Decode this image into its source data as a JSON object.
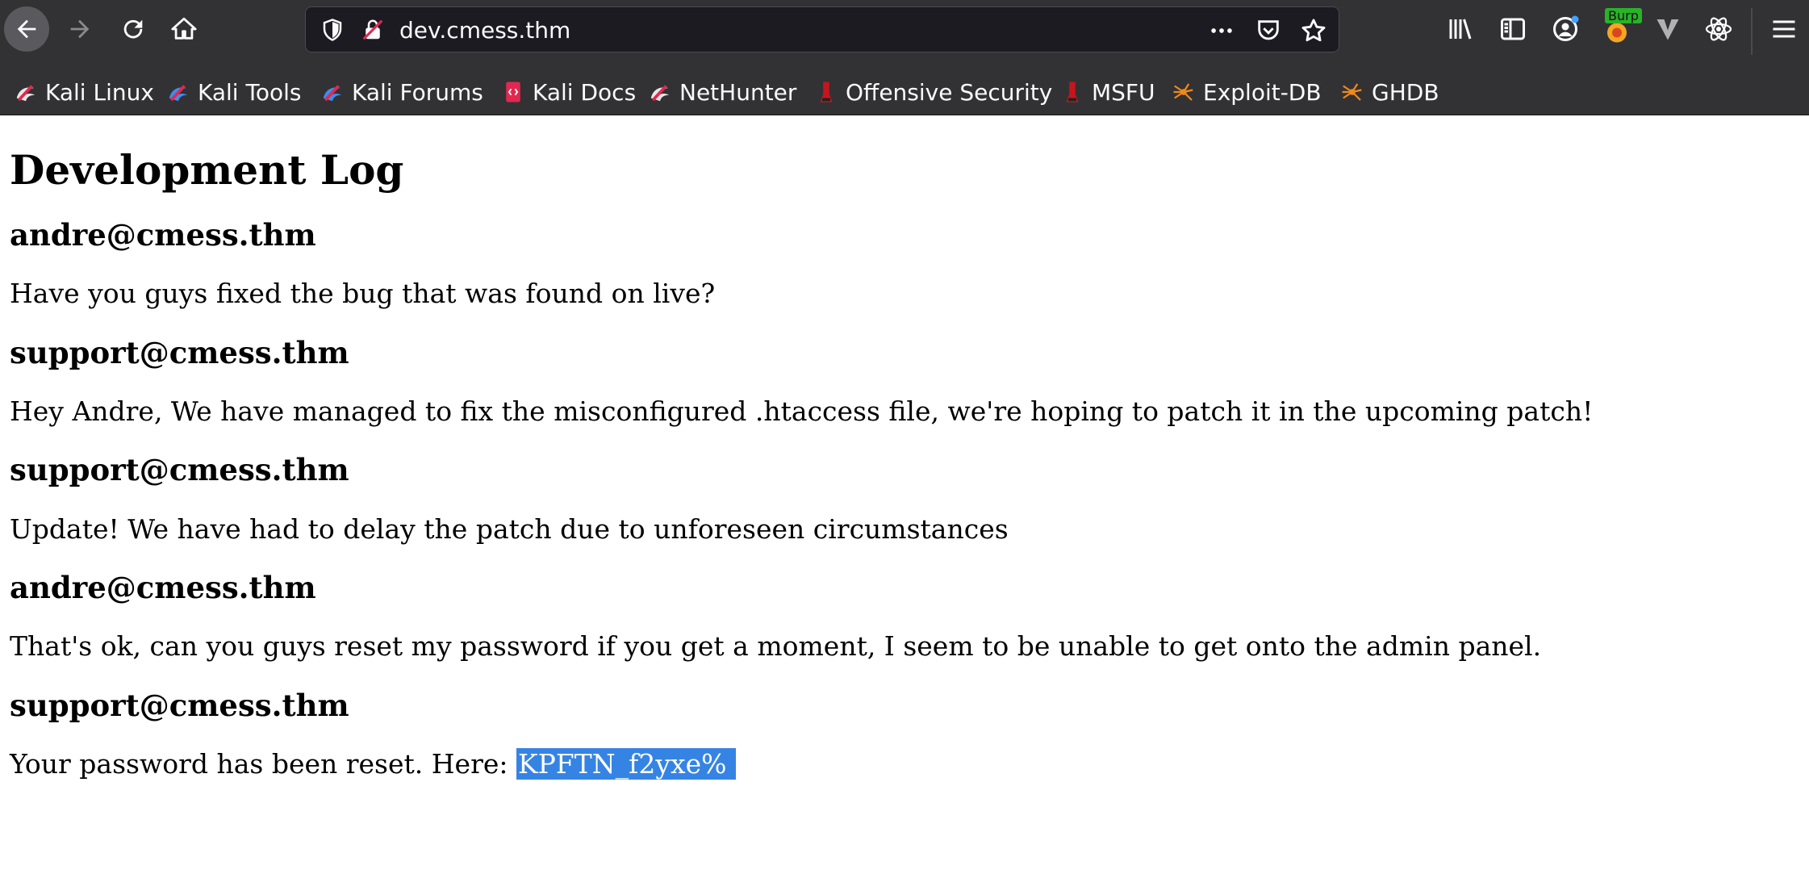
{
  "browser": {
    "url": "dev.cmess.thm",
    "burp_badge": "Burp",
    "bookmarks": [
      {
        "label": "Kali Linux",
        "icon": "kali-dragon-icon"
      },
      {
        "label": "Kali Tools",
        "icon": "kali-tools-icon"
      },
      {
        "label": "Kali Forums",
        "icon": "kali-forums-icon"
      },
      {
        "label": "Kali Docs",
        "icon": "kali-docs-icon"
      },
      {
        "label": "NetHunter",
        "icon": "nethunter-icon"
      },
      {
        "label": "Offensive Security",
        "icon": "offsec-icon"
      },
      {
        "label": "MSFU",
        "icon": "msfu-icon"
      },
      {
        "label": "Exploit-DB",
        "icon": "exploit-db-spider-icon"
      },
      {
        "label": "GHDB",
        "icon": "ghdb-spider-icon"
      }
    ]
  },
  "page": {
    "title": "Development Log",
    "entries": [
      {
        "author": "andre@cmess.thm",
        "message": "Have you guys fixed the bug that was found on live?"
      },
      {
        "author": "support@cmess.thm",
        "message": "Hey Andre, We have managed to fix the misconfigured .htaccess file, we're hoping to patch it in the upcoming patch!"
      },
      {
        "author": "support@cmess.thm",
        "message": "Update! We have had to delay the patch due to unforeseen circumstances"
      },
      {
        "author": "andre@cmess.thm",
        "message": "That's ok, can you guys reset my password if you get a moment, I seem to be unable to get onto the admin panel."
      },
      {
        "author": "support@cmess.thm",
        "message": "Your password has been reset. Here: ",
        "highlighted": "KPFTN_f2yxe%"
      }
    ]
  },
  "colors": {
    "chrome_bg": "#323234",
    "urlbar_bg": "#1c1b22",
    "selection": "#3584e4"
  }
}
